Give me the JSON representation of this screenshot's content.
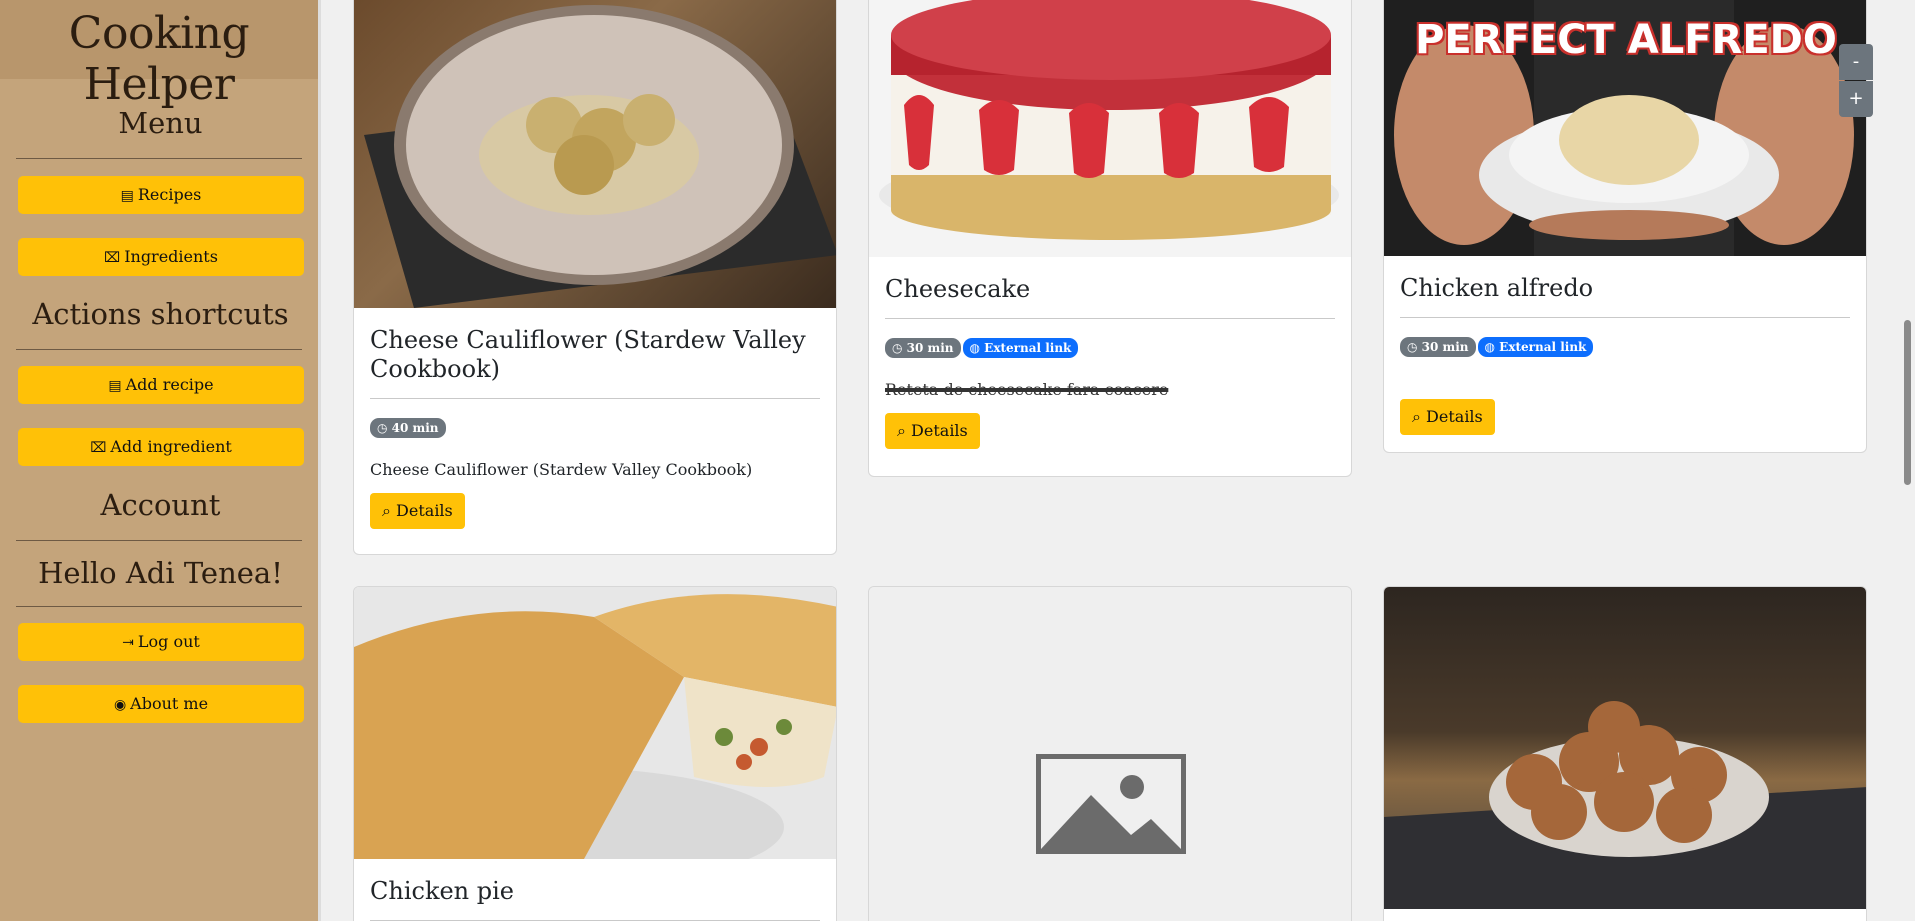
{
  "sidebar": {
    "brand": "Cooking Helper",
    "menu_title": "Menu",
    "recipes_label": "Recipes",
    "ingredients_label": "Ingredients",
    "shortcuts_title": "Actions shortcuts",
    "add_recipe_label": "Add recipe",
    "add_ingredient_label": "Add ingredient",
    "account_title": "Account",
    "greeting": "Hello Adi Tenea!",
    "logout_label": "Log out",
    "about_label": "About me"
  },
  "zoom": {
    "out": "-",
    "in": "+"
  },
  "cards": [
    {
      "title": "Cheese Cauliflower (Stardew Valley Cookbook)",
      "time": "40 min",
      "description": "Cheese Cauliflower (Stardew Valley Cookbook)",
      "details": "Details"
    },
    {
      "title": "Cheesecake",
      "time": "30 min",
      "link": "External link",
      "description": "Reteta de cheesecake fara coacere",
      "details": "Details"
    },
    {
      "title": "Chicken alfredo",
      "image_text": "PERFECT ALFREDO",
      "time": "30 min",
      "link": "External link",
      "details": "Details"
    },
    {
      "title": "Chicken pie"
    },
    {
      "title": ""
    },
    {
      "title": ""
    }
  ],
  "colors": {
    "sidebar_bg": "#c4a47b",
    "brand_bg": "#b8966c",
    "button": "#ffc107",
    "badge_time": "#6c757d",
    "badge_link": "#0d6efd"
  }
}
